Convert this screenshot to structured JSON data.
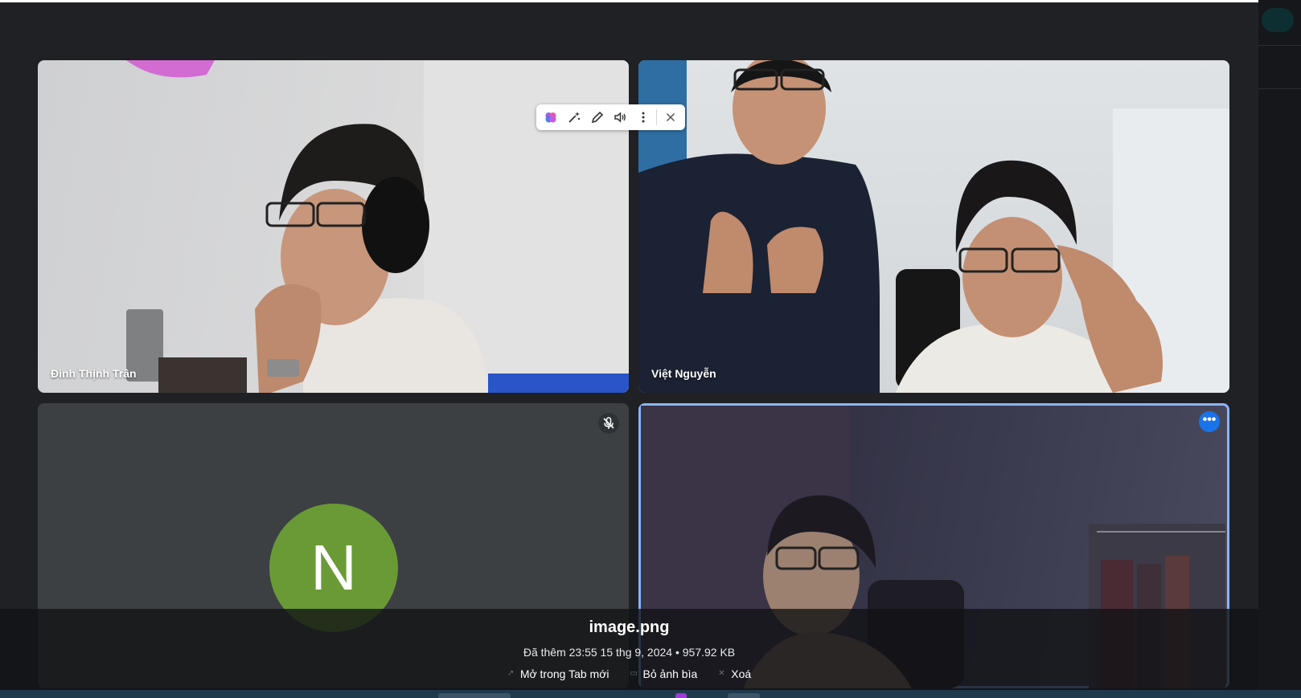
{
  "participants": [
    {
      "name": "Đinh Thịnh Trần"
    },
    {
      "name": "Việt Nguyễn"
    },
    {
      "name": "",
      "avatar_letter": "N",
      "avatar_color": "#6a9a35",
      "muted": true
    },
    {
      "name": "",
      "pinned": true
    }
  ],
  "toolbar": {
    "icons": [
      "brain-icon",
      "magic-wand-icon",
      "pencil-icon",
      "speaker-icon",
      "more-vert-icon",
      "close-icon"
    ]
  },
  "attachment": {
    "filename": "image.png",
    "meta": "Đã thêm 23:55 15 thg 9, 2024 • 957.92 KB",
    "actions": [
      "Mở trong Tab mới",
      "Bỏ ảnh bìa",
      "Xoá"
    ]
  },
  "colors": {
    "background": "#202124",
    "tile_empty": "#3c4043",
    "active_border": "#8ab4f8",
    "more_button": "#1a73e8"
  }
}
